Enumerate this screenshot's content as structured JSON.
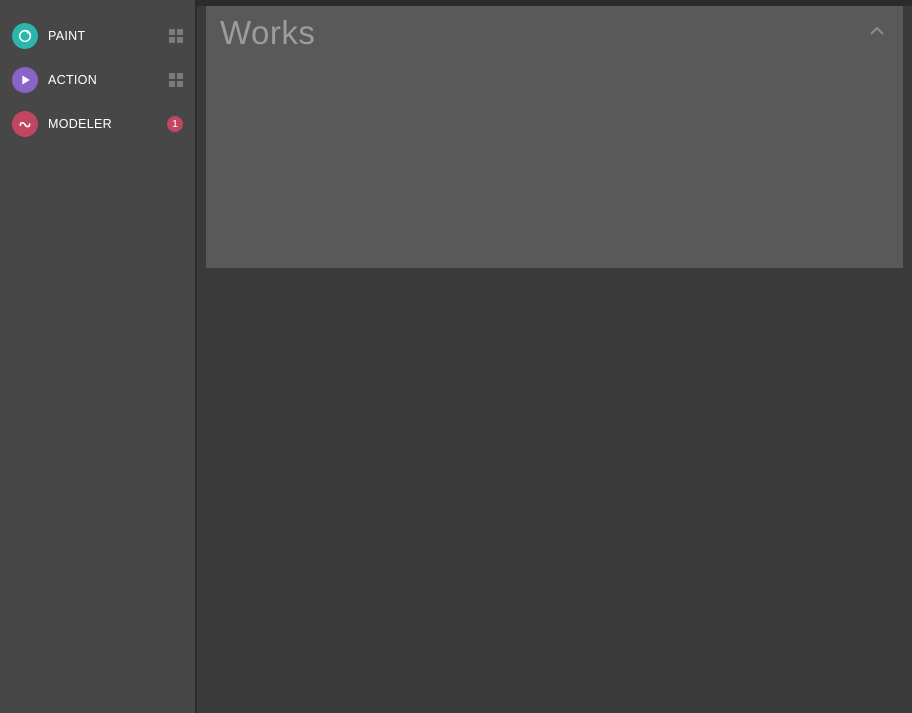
{
  "sidebar": {
    "items": [
      {
        "label": "PAINT",
        "icon_name": "paint-app-icon",
        "icon_bg": "#2bb5ab",
        "right_indicator": "grid"
      },
      {
        "label": "ACTION",
        "icon_name": "action-app-icon",
        "icon_bg": "#8764c6",
        "right_indicator": "grid"
      },
      {
        "label": "MODELER",
        "icon_name": "modeler-app-icon",
        "icon_bg": "#c1465f",
        "right_indicator": "badge",
        "badge_count": "1"
      }
    ]
  },
  "main": {
    "panel_title": "Works"
  },
  "colors": {
    "sidebar_bg": "#474747",
    "main_bg": "#3a3a3a",
    "panel_bg": "#595959",
    "badge_bg": "#c1465f"
  }
}
